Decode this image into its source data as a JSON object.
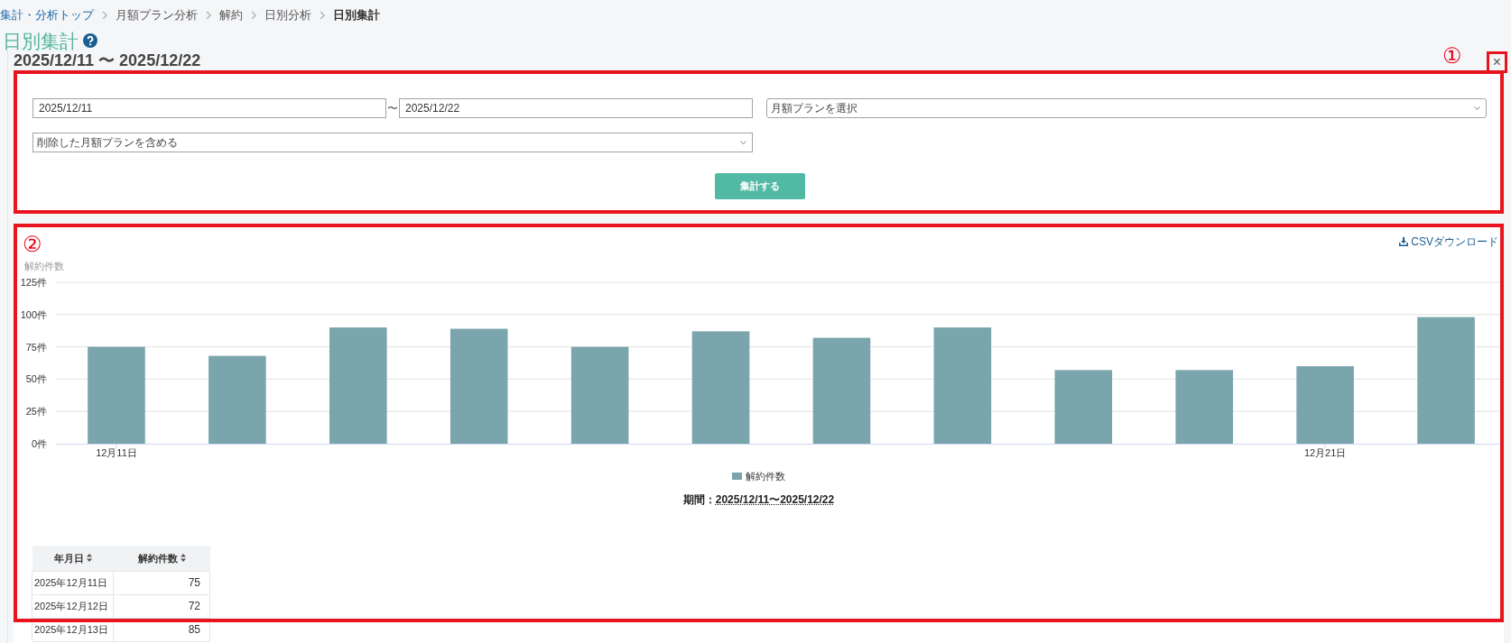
{
  "breadcrumb": [
    {
      "label": "集計・分析トップ",
      "kind": "link"
    },
    {
      "label": "月額プラン分析",
      "kind": "page"
    },
    {
      "label": "解約",
      "kind": "page"
    },
    {
      "label": "日別分析",
      "kind": "page"
    },
    {
      "label": "日別集計",
      "kind": "current"
    }
  ],
  "page_title": "日別集計",
  "header": {
    "date_range": "2025/12/11 〜 2025/12/22",
    "annotation": "①",
    "close_button": {
      "label": "×",
      "highlighted": true
    }
  },
  "filter_form": {
    "highlighted": true,
    "start_date": {
      "value": "2025/12/11"
    },
    "range_separator": "〜",
    "end_date": {
      "value": "2025/12/22"
    },
    "plan_select": {
      "value": "月額プランを選択"
    },
    "deleted_plan_select": {
      "value": "削除した月額プランを含める"
    },
    "submit_button": "集計する"
  },
  "report": {
    "highlighted": true,
    "annotation": "②",
    "csv_link": "CSVダウンロード",
    "chart_data": {
      "type": "bar",
      "ylabel": "解約件数",
      "categories": [
        "12月11日",
        null,
        null,
        null,
        null,
        null,
        null,
        null,
        null,
        null,
        "12月21日",
        null
      ],
      "series": [
        {
          "name": "解約件数",
          "color": "#7aa5ad",
          "values": [
            75,
            68,
            90,
            89,
            75,
            87,
            82,
            90,
            57,
            57,
            60,
            98
          ]
        }
      ],
      "ylim": [
        0,
        125
      ],
      "yticks": [
        {
          "value": 0,
          "label": "0件"
        },
        {
          "value": 25,
          "label": "25件"
        },
        {
          "value": 50,
          "label": "50件"
        },
        {
          "value": 75,
          "label": "75件"
        },
        {
          "value": 100,
          "label": "100件"
        },
        {
          "value": 125,
          "label": "125件"
        }
      ],
      "grid": true
    },
    "period": {
      "label": "期間：",
      "value": "2025/12/11〜2025/12/22"
    },
    "table": {
      "columns": [
        {
          "label": "年月日",
          "sortable": true
        },
        {
          "label": "解約件数",
          "sortable": true
        }
      ],
      "rows": [
        [
          "2025年12月11日",
          "75"
        ],
        [
          "2025年12月12日",
          "72"
        ],
        [
          "2025年12月13日",
          "85"
        ]
      ]
    }
  }
}
